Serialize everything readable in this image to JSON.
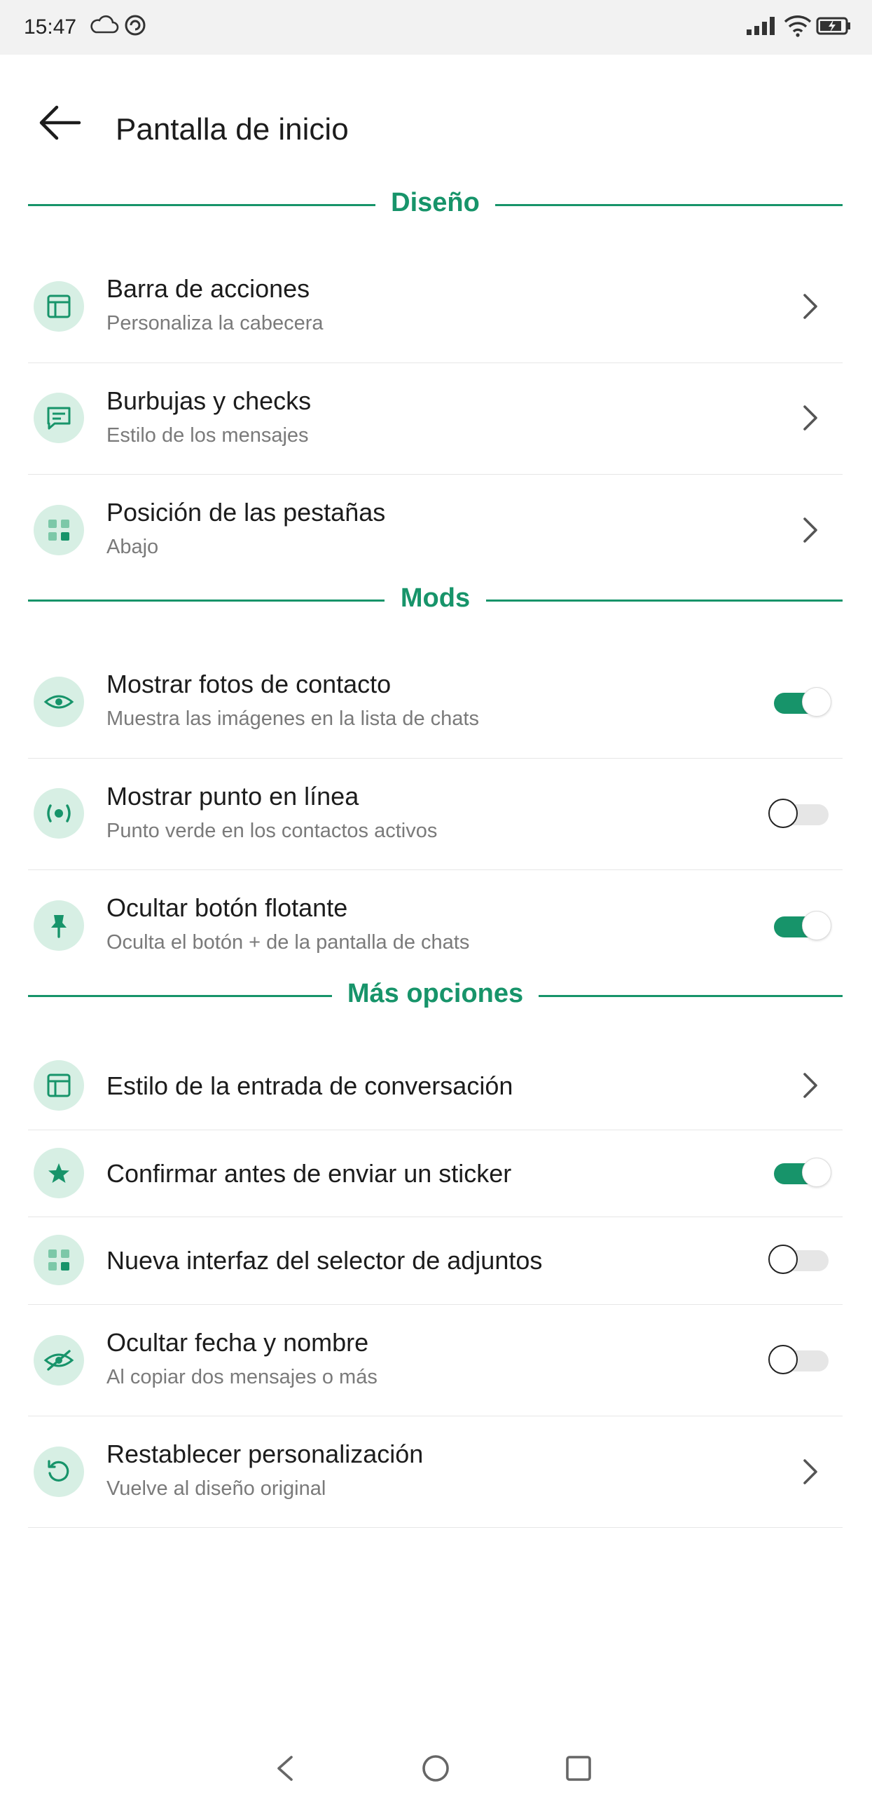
{
  "status_bar": {
    "time": "15:47"
  },
  "header": {
    "title": "Pantalla de inicio"
  },
  "sections": {
    "design": {
      "label": "Diseño",
      "items": [
        {
          "title": "Barra de acciones",
          "subtitle": "Personaliza la cabecera",
          "icon": "layout-icon"
        },
        {
          "title": "Burbujas y checks",
          "subtitle": "Estilo de los mensajes",
          "icon": "message-icon"
        },
        {
          "title": "Posición de las pestañas",
          "subtitle": "Abajo",
          "icon": "grid-icon"
        }
      ]
    },
    "mods": {
      "label": "Mods",
      "items": [
        {
          "title": "Mostrar fotos de contacto",
          "subtitle": "Muestra las imágenes en la lista de chats",
          "icon": "eye-icon",
          "enabled": true
        },
        {
          "title": "Mostrar punto en línea",
          "subtitle": "Punto verde en los contactos activos",
          "icon": "online-dot-icon",
          "enabled": false
        },
        {
          "title": "Ocultar botón flotante",
          "subtitle": "Oculta el botón + de la pantalla de chats",
          "icon": "pin-icon",
          "enabled": true
        }
      ]
    },
    "more": {
      "label": "Más opciones",
      "items": [
        {
          "title": "Estilo de la entrada de conversación",
          "icon": "layout-icon"
        },
        {
          "title": "Confirmar antes de enviar un sticker",
          "icon": "star-icon",
          "enabled": true
        },
        {
          "title": "Nueva interfaz del selector de adjuntos",
          "icon": "grid-icon",
          "enabled": false
        },
        {
          "title": "Ocultar fecha y nombre",
          "subtitle": "Al copiar dos mensajes o más",
          "icon": "eye-off-icon",
          "enabled": false
        },
        {
          "title": "Restablecer personalización",
          "subtitle": "Vuelve al diseño original",
          "icon": "reset-icon"
        }
      ]
    }
  },
  "colors": {
    "accent": "#17946a",
    "icon_background": "#d7efe4",
    "subtitle": "#7a7a7a"
  }
}
